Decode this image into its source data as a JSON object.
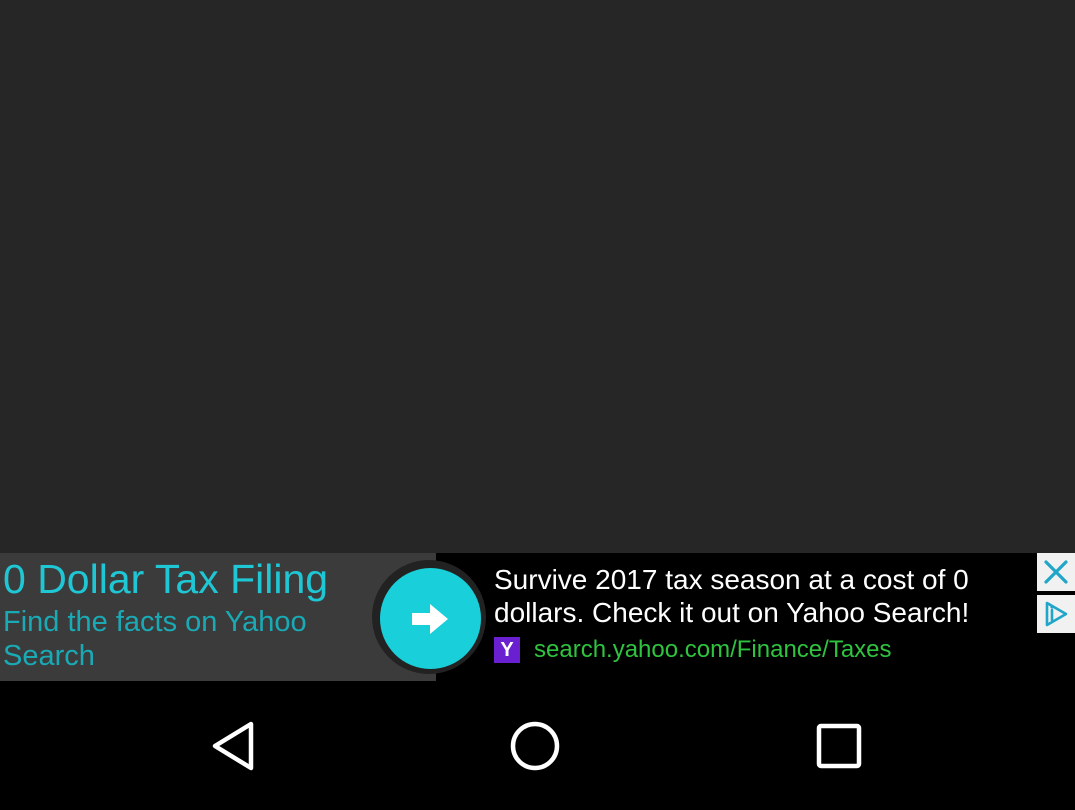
{
  "ad": {
    "headline": "0 Dollar Tax Filing",
    "subline": "Find the facts on Yahoo Search",
    "description": "Survive 2017 tax season at a cost of 0 dollars. Check it out on Yahoo Search!",
    "source_logo": "Y",
    "url": "search.yahoo.com/Finance/Taxes",
    "cta_icon": "arrow-right-icon",
    "close_icon": "close-icon",
    "choices_icon": "adchoices-icon",
    "colors": {
      "headline": "#1fc7d4",
      "cta": "#19cfd9",
      "url": "#2fc43f",
      "logo": "#6a1fd0"
    }
  },
  "navbar": {
    "back_icon": "back-triangle-icon",
    "home_icon": "home-circle-icon",
    "recents_icon": "recents-square-icon"
  }
}
